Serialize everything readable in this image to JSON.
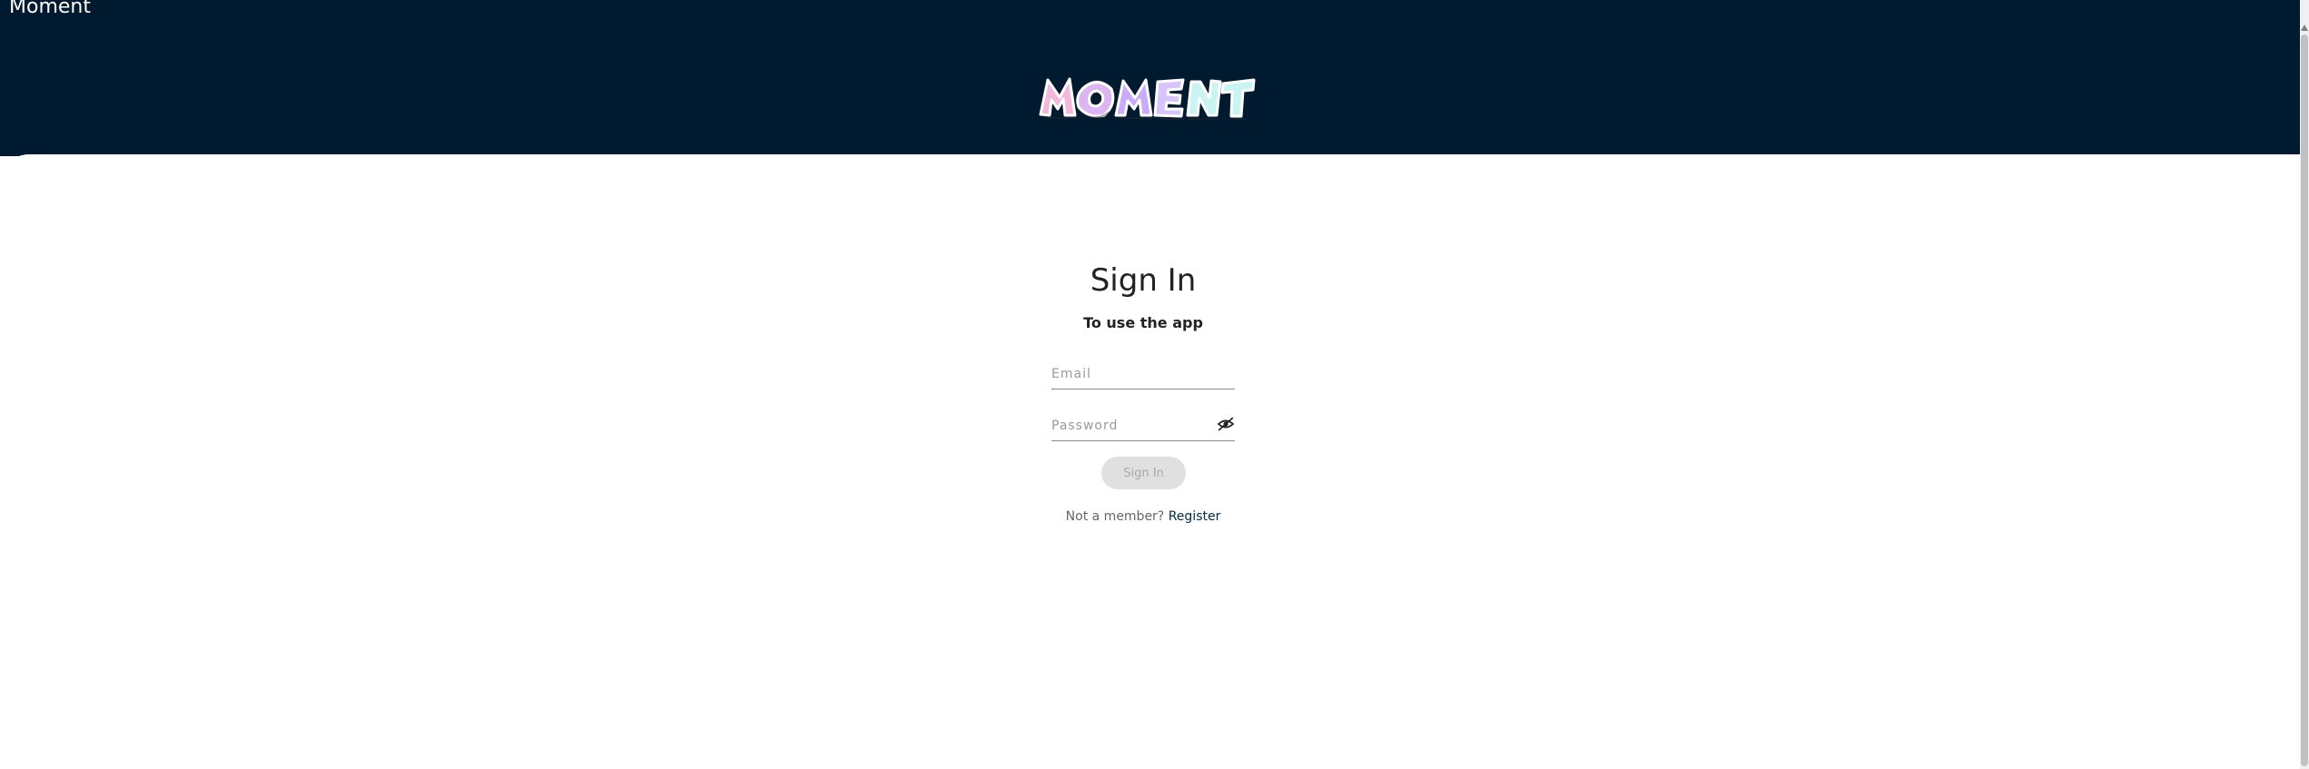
{
  "window": {
    "title": "Moment"
  },
  "header": {
    "logo_text": "MOMENT"
  },
  "signin": {
    "title": "Sign In",
    "subtitle": "To use the app",
    "email_placeholder": "Email",
    "email_value": "",
    "password_placeholder": "Password",
    "password_value": "",
    "submit_label": "Sign In",
    "register_prompt": "Not a member?",
    "register_link": "Register"
  },
  "icons": {
    "password_toggle": "eye-slash-icon",
    "scroll_up": "chevron-up-icon"
  },
  "colors": {
    "header_bg": "#001a2f",
    "logo_pink": "#f7b6d9",
    "logo_purple": "#c8a7ff",
    "logo_mint": "#c9f4f3",
    "button_disabled_bg": "#e0e0e0",
    "link": "#002b4a"
  }
}
